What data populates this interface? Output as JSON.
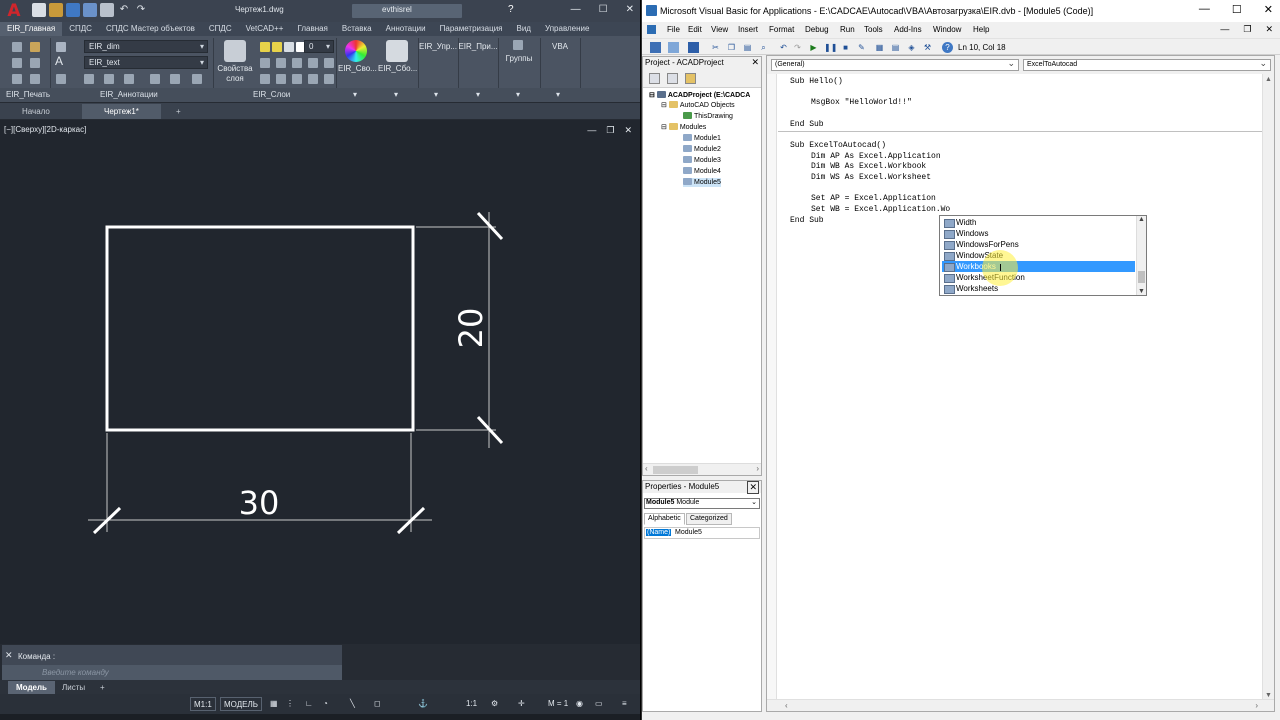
{
  "acad": {
    "logo": "A",
    "doc_name": "Чертеж1.dwg",
    "user": "evthisrel",
    "help": "?",
    "ribbon_tabs": [
      "EIR_Главная",
      "СПДС",
      "СПДС Мастер объектов",
      "СПДС",
      "VetCAD++",
      "Главная",
      "Вставка",
      "Аннотации",
      "Параметризация",
      "Вид",
      "Управление"
    ],
    "ribbon": {
      "dim_combo": "EIR_dim",
      "text_combo": "EIR_text",
      "layer_num": "0",
      "layer_props": "Свойства\nслоя",
      "btn_props": "EIR_Сво...",
      "btn_collect": "EIR_Сбо...",
      "btn_manage": "EIR_Упр...",
      "btn_pri": "EIR_При...",
      "btn_groups": "Группы",
      "btn_vba": "VBA",
      "panel_print": "EIR_Печать",
      "panel_annot": "EIR_Аннотации",
      "panel_layers": "EIR_Слои"
    },
    "file_tabs": {
      "start": "Начало",
      "drawing": "Чертеж1*",
      "add": "+"
    },
    "viewport_label": "[−][Сверху][2D-каркас]",
    "dims": {
      "vertical": "20",
      "horizontal": "30"
    },
    "command": {
      "label": "Команда :",
      "placeholder": "Введите команду"
    },
    "layout_tabs": {
      "model": "Модель",
      "sheets": "Листы",
      "add": "+"
    },
    "status": {
      "scale1": "М1:1",
      "model": "МОДЕЛЬ",
      "scale2": "1:1",
      "annot": "М = 1"
    }
  },
  "vba": {
    "title": "Microsoft Visual Basic for Applications - E:\\CADCAE\\Autocad\\VBA\\Автозагрузка\\EIR.dvb - [Module5 (Code)]",
    "menu": [
      "File",
      "Edit",
      "View",
      "Insert",
      "Format",
      "Debug",
      "Run",
      "Tools",
      "Add-Ins",
      "Window",
      "Help"
    ],
    "cursor_pos": "Ln 10, Col 18",
    "project": {
      "title": "Project - ACADProject",
      "root": "ACADProject (E:\\CADCA",
      "autocad_objects": "AutoCAD Objects",
      "this_drawing": "ThisDrawing",
      "modules_folder": "Modules",
      "modules": [
        "Module1",
        "Module2",
        "Module3",
        "Module4",
        "Module5"
      ]
    },
    "properties": {
      "title": "Properties - Module5",
      "object": "Module5",
      "object_type": "Module",
      "tab_alpha": "Alphabetic",
      "tab_cat": "Categorized",
      "key": "(Name)",
      "value": "Module5"
    },
    "code": {
      "general_combo": "(General)",
      "proc_combo": "ExcelToAutocad",
      "lines": [
        "Sub Hello()",
        "MsgBox \"HelloWorld!!\"",
        "End Sub",
        "Sub ExcelToAutocad()",
        "Dim AP As Excel.Application",
        "Dim WB As Excel.Workbook",
        "Dim WS As Excel.Worksheet",
        "Set AP = Excel.Application",
        "Set WB = Excel.Application.Wo",
        "End Sub"
      ]
    },
    "intellisense": [
      "Width",
      "Windows",
      "WindowsForPens",
      "WindowState",
      "Workbooks",
      "WorksheetFunction",
      "Worksheets"
    ],
    "intellisense_selected": "Workbooks"
  }
}
